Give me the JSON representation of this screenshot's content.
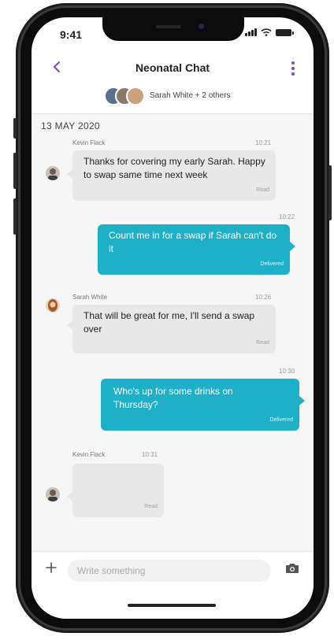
{
  "status_bar": {
    "time": "9:41"
  },
  "header": {
    "title": "Neonatal Chat",
    "back_icon": "chevron-left-icon",
    "menu_icon": "kebab-menu-icon",
    "participants_label": "Sarah White + 2 others"
  },
  "chat": {
    "date": "13 MAY 2020",
    "messages": [
      {
        "direction": "incoming",
        "sender": "Kevin Flack",
        "time": "10:21",
        "text": "Thanks for covering my early Sarah. Happy to swap same time next week",
        "status": "Read"
      },
      {
        "direction": "outgoing",
        "time": "10:22",
        "text": "Count me in for a swap if Sarah can't do it",
        "status": "Delivered"
      },
      {
        "direction": "incoming",
        "sender": "Sarah White",
        "time": "10:26",
        "text": "That will be great for me, I'll send a swap over",
        "status": "Read"
      },
      {
        "direction": "outgoing",
        "time": "10:30",
        "text": "Who's up for some drinks on Thursday?",
        "status": "Delivered"
      },
      {
        "direction": "incoming",
        "sender": "Kevin Flack",
        "time": "10:31",
        "text": "",
        "status": "Read"
      }
    ]
  },
  "composer": {
    "placeholder": "Write something",
    "plus_icon": "plus-icon",
    "camera_icon": "camera-icon"
  },
  "colors": {
    "accent": "#7b48c8",
    "outgoing_bubble": "#1fb0c9",
    "incoming_bubble": "#e8e8e8",
    "chat_background": "#f6f6f6"
  }
}
